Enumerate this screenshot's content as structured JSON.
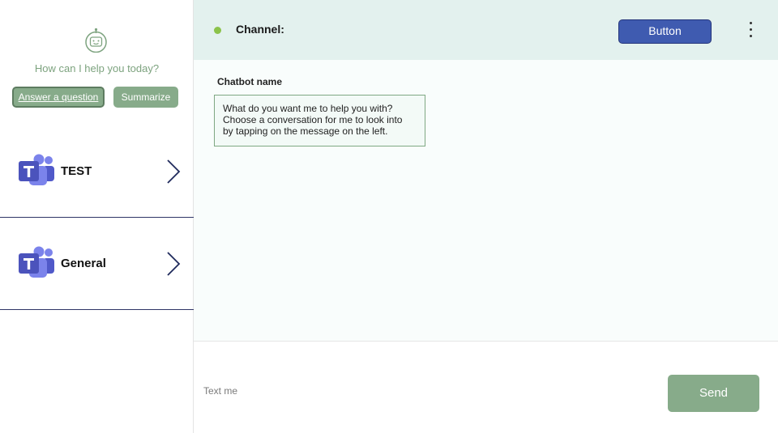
{
  "sidebar": {
    "help_prompt": "How can I help you today?",
    "chips": {
      "answer_label": "Answer a question",
      "summarize_label": "Summarize"
    },
    "channels": [
      {
        "label": "TEST",
        "icon": "teams-icon"
      },
      {
        "label": "General",
        "icon": "teams-icon"
      }
    ]
  },
  "header": {
    "channel_label": "Channel:",
    "button_label": "Button",
    "status_color": "#8bc34a"
  },
  "chat": {
    "bot_name": "Chatbot name",
    "messages": [
      {
        "line1": "What do you want me to help you with?",
        "line2": "Choose a conversation for me to look into",
        "line3": "by tapping on the message on the left."
      }
    ]
  },
  "composer": {
    "placeholder": "Text me",
    "value": "",
    "send_label": "Send"
  },
  "colors": {
    "accent_green": "#87ab8a",
    "header_bg": "#e3f1ee",
    "button_blue": "#3f5bb0",
    "divider_navy": "#2e3566"
  }
}
